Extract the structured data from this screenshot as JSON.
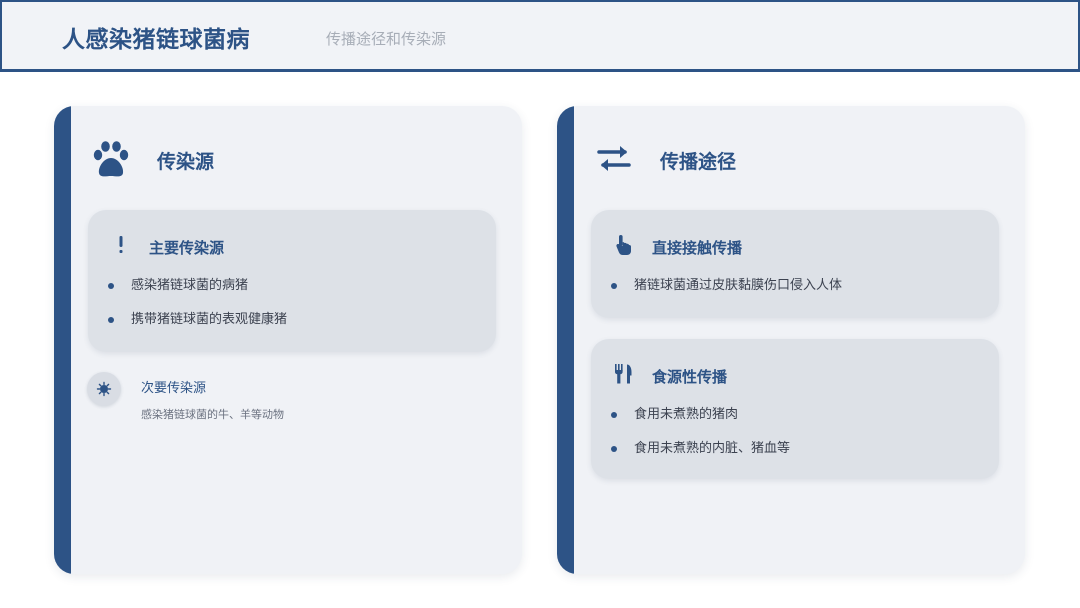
{
  "header": {
    "title": "人感染猪链球菌病",
    "subtitle": "传播途径和传染源"
  },
  "left_panel": {
    "title": "传染源",
    "icon": "paw-icon",
    "primary_card": {
      "title": "主要传染源",
      "icon": "exclamation-icon",
      "items": [
        "感染猪链球菌的病猪",
        "携带猪链球菌的表观健康猪"
      ]
    },
    "secondary": {
      "title": "次要传染源",
      "icon": "virus-icon",
      "description": "感染猪链球菌的牛、羊等动物"
    }
  },
  "right_panel": {
    "title": "传播途径",
    "icon": "exchange-arrows-icon",
    "direct_card": {
      "title": "直接接触传播",
      "icon": "hand-pointer-icon",
      "items": [
        "猪链球菌通过皮肤黏膜伤口侵入人体"
      ]
    },
    "food_card": {
      "title": "食源性传播",
      "icon": "utensils-icon",
      "items": [
        "食用未煮熟的猪肉",
        "食用未煮熟的内脏、猪血等"
      ]
    }
  },
  "colors": {
    "accent": "#2d5386",
    "panel_bg": "#f0f2f6",
    "card_bg": "#dde1e7",
    "subtitle": "#a7adb7"
  }
}
